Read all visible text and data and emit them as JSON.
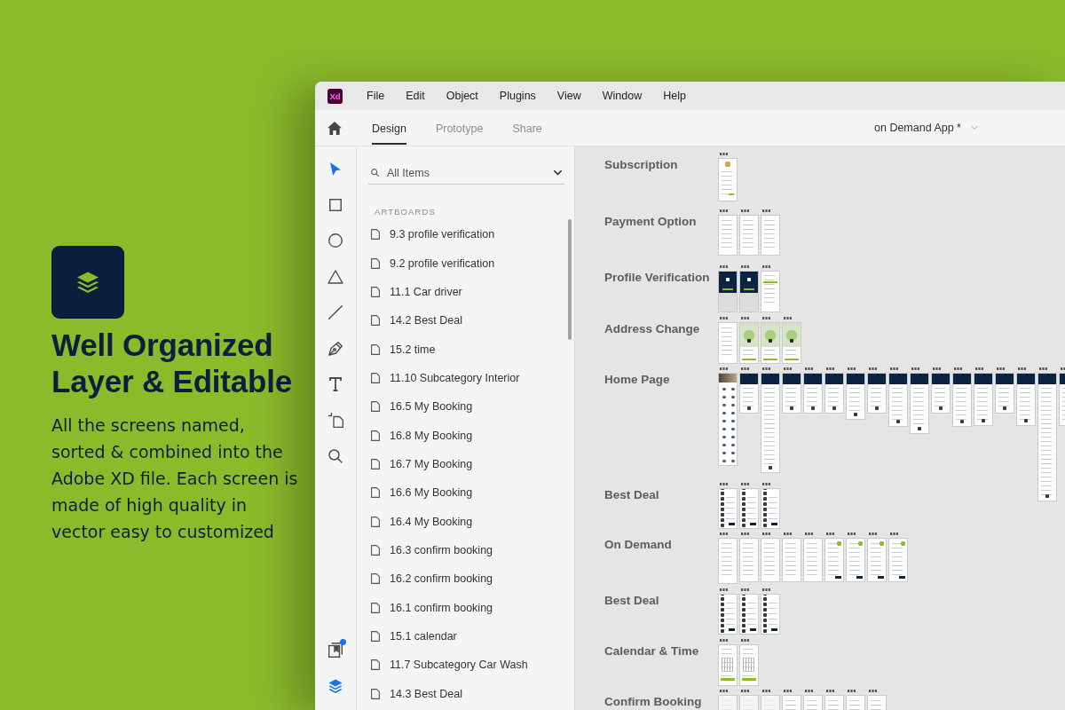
{
  "promo": {
    "title": "Well Organized Layer & Editable",
    "text": "All the screens named, sorted & combined into the Adobe XD file. Each screen is made of high quality in vector easy to customized"
  },
  "window": {
    "logo": "Xd",
    "menu": [
      "File",
      "Edit",
      "Object",
      "Plugins",
      "View",
      "Window",
      "Help"
    ],
    "tabs": [
      {
        "label": "Design",
        "selected": true
      },
      {
        "label": "Prototype",
        "selected": false
      },
      {
        "label": "Share",
        "selected": false
      }
    ],
    "document_title": "on Demand App *"
  },
  "tools": [
    {
      "kind": "select",
      "selected": true
    },
    {
      "kind": "rectangle",
      "selected": false
    },
    {
      "kind": "ellipse",
      "selected": false
    },
    {
      "kind": "triangle",
      "selected": false
    },
    {
      "kind": "line",
      "selected": false
    },
    {
      "kind": "pen",
      "selected": false
    },
    {
      "kind": "text",
      "selected": false
    },
    {
      "kind": "artboard",
      "selected": false
    },
    {
      "kind": "zoom",
      "selected": false
    }
  ],
  "panel_tools": [
    {
      "kind": "assets",
      "selected": false,
      "notification": true
    },
    {
      "kind": "layers",
      "selected": true
    }
  ],
  "layers_panel": {
    "search": {
      "placeholder": "All Items"
    },
    "section": "ARTBOARDS",
    "items": [
      {
        "label": "9.3 profile verification",
        "selected": false
      },
      {
        "label": "9.2 profile verification",
        "selected": false
      },
      {
        "label": "11.1 Car driver",
        "selected": false
      },
      {
        "label": "14.2 Best Deal",
        "selected": false
      },
      {
        "label": "15.2 time",
        "selected": false
      },
      {
        "label": "11.10 Subcategory Interior",
        "selected": false
      },
      {
        "label": "16.5 My Booking",
        "selected": false
      },
      {
        "label": "16.8 My Booking",
        "selected": false
      },
      {
        "label": "16.7 My Booking",
        "selected": false
      },
      {
        "label": "16.6 My Booking",
        "selected": false
      },
      {
        "label": "16.4 My Booking",
        "selected": false
      },
      {
        "label": "16.3 confirm booking",
        "selected": false
      },
      {
        "label": "16.2 confirm booking",
        "selected": false
      },
      {
        "label": "16.1 confirm booking",
        "selected": false
      },
      {
        "label": "15.1 calendar",
        "selected": false
      },
      {
        "label": "11.7 Subcategory Car Wash",
        "selected": false
      },
      {
        "label": "14.3 Best Deal",
        "selected": false
      }
    ]
  },
  "canvas": {
    "groups": [
      {
        "label": "Subscription",
        "artboards": [
          {
            "kind": "profile"
          }
        ]
      },
      {
        "label": "Payment Option",
        "artboards": [
          {
            "kind": "plain"
          },
          {
            "kind": "plain"
          },
          {
            "kind": "plain"
          }
        ]
      },
      {
        "label": "Profile Verification",
        "artboards": [
          {
            "kind": "dark-top"
          },
          {
            "kind": "dark-top"
          },
          {
            "kind": "form"
          }
        ]
      },
      {
        "label": "Address Change",
        "artboards": [
          {
            "kind": "plain"
          },
          {
            "kind": "map"
          },
          {
            "kind": "map"
          },
          {
            "kind": "map"
          }
        ]
      },
      {
        "label": "Home Page",
        "artboards": [
          {
            "kind": "photo"
          },
          {
            "kind": "dark-header"
          },
          {
            "kind": "dark-header"
          },
          {
            "kind": "dark-header"
          },
          {
            "kind": "dark-header"
          },
          {
            "kind": "dark-header"
          },
          {
            "kind": "dark-header"
          },
          {
            "kind": "dark-header"
          },
          {
            "kind": "dark-header"
          },
          {
            "kind": "dark-header"
          },
          {
            "kind": "dark-header"
          },
          {
            "kind": "dark-header"
          },
          {
            "kind": "dark-header"
          },
          {
            "kind": "dark-header"
          },
          {
            "kind": "dark-header"
          },
          {
            "kind": "dark-header"
          },
          {
            "kind": "dark-header"
          }
        ]
      },
      {
        "label": "Best Deal",
        "artboards": [
          {
            "kind": "list"
          },
          {
            "kind": "list"
          },
          {
            "kind": "list"
          }
        ]
      },
      {
        "label": "On Demand",
        "artboards": [
          {
            "kind": "plain"
          },
          {
            "kind": "plain"
          },
          {
            "kind": "plain"
          },
          {
            "kind": "plain"
          },
          {
            "kind": "plain"
          },
          {
            "kind": "status"
          },
          {
            "kind": "status"
          },
          {
            "kind": "status"
          },
          {
            "kind": "status"
          }
        ]
      },
      {
        "label": "Best Deal",
        "artboards": [
          {
            "kind": "list"
          },
          {
            "kind": "list"
          },
          {
            "kind": "list"
          }
        ]
      },
      {
        "label": "Calendar & Time",
        "artboards": [
          {
            "kind": "calendar"
          },
          {
            "kind": "calendar"
          }
        ]
      },
      {
        "label": "Confirm Booking",
        "artboards": [
          {
            "kind": "blank"
          },
          {
            "kind": "blank"
          },
          {
            "kind": "blank"
          },
          {
            "kind": "plain"
          },
          {
            "kind": "plain"
          },
          {
            "kind": "plain"
          },
          {
            "kind": "plain"
          },
          {
            "kind": "plain"
          }
        ]
      }
    ]
  }
}
